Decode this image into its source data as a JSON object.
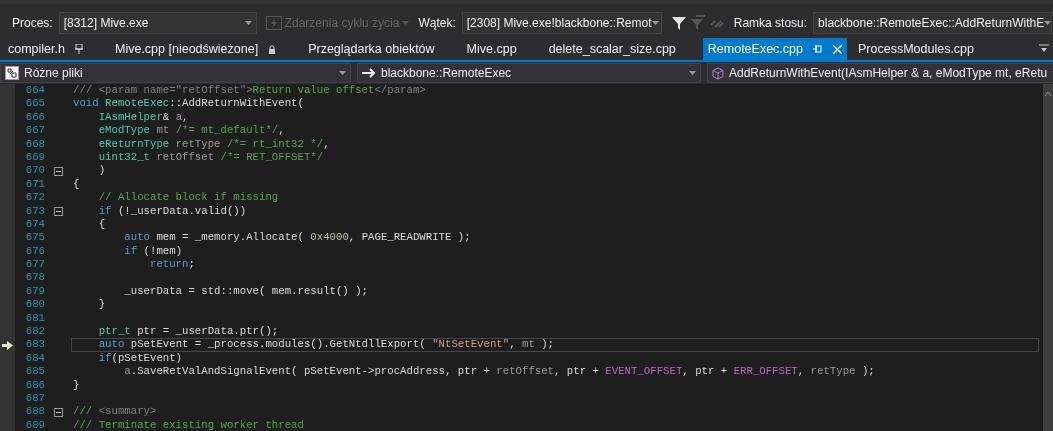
{
  "toolbar": {
    "process_label": "Proces:",
    "process_value": "[8312] Mive.exe",
    "lifecycle_label": "Zdarzenia cyklu życia",
    "lifecycle_disabled": true,
    "thread_label": "Wątek:",
    "thread_value": "[2308] Mive.exe!blackbone::Remot",
    "frame_label": "Ramka stosu:",
    "frame_value": "blackbone::RemoteExec::AddReturnWithE"
  },
  "tabs": [
    {
      "label": "compiler.h",
      "selected": false,
      "pinned": true,
      "read_only": false
    },
    {
      "label": "Mive.cpp [nieodświeżone]",
      "selected": false,
      "pinned": false,
      "read_only": true
    },
    {
      "label": "Przeglądarka obiektów",
      "selected": false,
      "pinned": false,
      "read_only": false
    },
    {
      "label": "Mive.cpp",
      "selected": false,
      "pinned": false,
      "read_only": false
    },
    {
      "label": "delete_scalar_size.cpp",
      "selected": false,
      "pinned": false,
      "read_only": false
    },
    {
      "label": "RemoteExec.cpp",
      "selected": true,
      "pinned": false,
      "read_only": false
    },
    {
      "label": "ProcessModules.cpp",
      "selected": false,
      "pinned": false,
      "read_only": false
    }
  ],
  "nav_bar": {
    "project": "Różne pliki",
    "scope": "blackbone::RemoteExec",
    "member": "AddReturnWithEvent(IAsmHelper & a, eModType mt, eRetu"
  },
  "code": [
    {
      "number": "664",
      "collapsible": false,
      "current": false,
      "tokens": [
        {
          "kind": "doc",
          "text": "/// <param name=\"retOffset\">"
        },
        {
          "kind": "comment",
          "text": "Return value offset"
        },
        {
          "kind": "doc",
          "text": "</param>"
        }
      ]
    },
    {
      "number": "665",
      "collapsible": false,
      "current": false,
      "tokens": [
        {
          "kind": "keyword",
          "text": "void "
        },
        {
          "kind": "type",
          "text": "RemoteExec"
        },
        {
          "kind": "plain",
          "text": "::AddReturnWithEvent("
        }
      ]
    },
    {
      "number": "666",
      "collapsible": false,
      "current": false,
      "tokens": [
        {
          "kind": "type",
          "text": "    IAsmHelper"
        },
        {
          "kind": "plain",
          "text": "& "
        },
        {
          "kind": "param",
          "text": "a"
        },
        {
          "kind": "plain",
          "text": ","
        }
      ]
    },
    {
      "number": "667",
      "collapsible": false,
      "current": false,
      "tokens": [
        {
          "kind": "type",
          "text": "    eModType "
        },
        {
          "kind": "param",
          "text": "mt"
        },
        {
          "kind": "comment",
          "text": " /*= mt_default*/"
        },
        {
          "kind": "plain",
          "text": ","
        }
      ]
    },
    {
      "number": "668",
      "collapsible": false,
      "current": false,
      "tokens": [
        {
          "kind": "type",
          "text": "    eReturnType "
        },
        {
          "kind": "param",
          "text": "retType"
        },
        {
          "kind": "comment",
          "text": " /*= rt_int32 */"
        },
        {
          "kind": "plain",
          "text": ","
        }
      ]
    },
    {
      "number": "669",
      "collapsible": false,
      "current": false,
      "tokens": [
        {
          "kind": "type",
          "text": "    uint32_t "
        },
        {
          "kind": "param",
          "text": "retOffset"
        },
        {
          "kind": "comment",
          "text": " /*= RET_OFFSET*/"
        }
      ]
    },
    {
      "number": "670",
      "collapsible": true,
      "current": false,
      "tokens": [
        {
          "kind": "plain",
          "text": "    )"
        }
      ]
    },
    {
      "number": "671",
      "collapsible": false,
      "current": false,
      "tokens": [
        {
          "kind": "plain",
          "text": "{"
        }
      ]
    },
    {
      "number": "672",
      "collapsible": false,
      "current": false,
      "tokens": [
        {
          "kind": "comment",
          "text": "    // Allocate block if missing"
        }
      ]
    },
    {
      "number": "673",
      "collapsible": true,
      "current": false,
      "tokens": [
        {
          "kind": "keyword",
          "text": "    if "
        },
        {
          "kind": "plain",
          "text": "(!_userData.valid())"
        }
      ]
    },
    {
      "number": "674",
      "collapsible": false,
      "current": false,
      "tokens": [
        {
          "kind": "plain",
          "text": "    {"
        }
      ]
    },
    {
      "number": "675",
      "collapsible": false,
      "current": false,
      "tokens": [
        {
          "kind": "keyword",
          "text": "        auto "
        },
        {
          "kind": "plain",
          "text": "mem = _memory.Allocate( "
        },
        {
          "kind": "number",
          "text": "0x4000"
        },
        {
          "kind": "plain",
          "text": ", PAGE_READWRITE );"
        }
      ]
    },
    {
      "number": "676",
      "collapsible": false,
      "current": false,
      "tokens": [
        {
          "kind": "keyword",
          "text": "        if "
        },
        {
          "kind": "plain",
          "text": "(!mem)"
        }
      ]
    },
    {
      "number": "677",
      "collapsible": false,
      "current": false,
      "tokens": [
        {
          "kind": "keyword",
          "text": "            return"
        },
        {
          "kind": "plain",
          "text": ";"
        }
      ]
    },
    {
      "number": "678",
      "collapsible": false,
      "current": false
    },
    {
      "number": "679",
      "collapsible": false,
      "current": false,
      "tokens": [
        {
          "kind": "plain",
          "text": "        _userData = std::move( mem.result() );"
        }
      ]
    },
    {
      "number": "680",
      "collapsible": false,
      "current": false,
      "tokens": [
        {
          "kind": "plain",
          "text": "    }"
        }
      ]
    },
    {
      "number": "681",
      "collapsible": false,
      "current": false
    },
    {
      "number": "682",
      "collapsible": false,
      "current": false,
      "tokens": [
        {
          "kind": "type",
          "text": "    ptr_t "
        },
        {
          "kind": "plain",
          "text": "ptr = _userData.ptr();"
        }
      ]
    },
    {
      "number": "683",
      "collapsible": false,
      "current": true,
      "tokens": [
        {
          "kind": "keyword",
          "text": "    auto "
        },
        {
          "kind": "plain",
          "text": "pSetEvent = _process.modules().GetNtdllExport( "
        },
        {
          "kind": "string",
          "text": "\"NtSetEvent\""
        },
        {
          "kind": "plain",
          "text": ", "
        },
        {
          "kind": "param",
          "text": "mt"
        },
        {
          "kind": "plain",
          "text": " );"
        }
      ]
    },
    {
      "number": "684",
      "collapsible": false,
      "current": false,
      "tokens": [
        {
          "kind": "keyword",
          "text": "    if"
        },
        {
          "kind": "plain",
          "text": "(pSetEvent)"
        }
      ]
    },
    {
      "number": "685",
      "collapsible": false,
      "current": false,
      "tokens": [
        {
          "kind": "param",
          "text": "        a"
        },
        {
          "kind": "plain",
          "text": ".SaveRetValAndSignalEvent( pSetEvent->procAddress, ptr + "
        },
        {
          "kind": "param",
          "text": "retOffset"
        },
        {
          "kind": "plain",
          "text": ", ptr + "
        },
        {
          "kind": "macro",
          "text": "EVENT_OFFSET"
        },
        {
          "kind": "plain",
          "text": ", ptr + "
        },
        {
          "kind": "macro",
          "text": "ERR_OFFSET"
        },
        {
          "kind": "plain",
          "text": ", "
        },
        {
          "kind": "param",
          "text": "retType"
        },
        {
          "kind": "plain",
          "text": " );"
        }
      ]
    },
    {
      "number": "686",
      "collapsible": false,
      "current": false,
      "tokens": [
        {
          "kind": "plain",
          "text": "}"
        }
      ]
    },
    {
      "number": "687",
      "collapsible": false,
      "current": false
    },
    {
      "number": "688",
      "collapsible": true,
      "current": false,
      "tokens": [
        {
          "kind": "comment",
          "text": "///"
        },
        {
          "kind": "doc",
          "text": " <summary>"
        }
      ]
    },
    {
      "number": "689",
      "collapsible": false,
      "current": false,
      "tokens": [
        {
          "kind": "comment",
          "text": "/// Terminate existing worker thread"
        }
      ]
    }
  ]
}
